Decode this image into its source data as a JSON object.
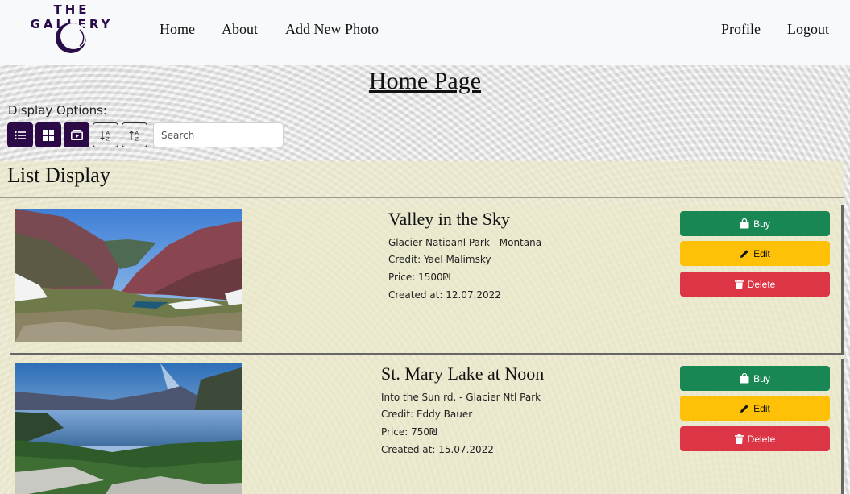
{
  "brand": {
    "name": "THE GALLERY",
    "logo_icon": "crescent-logo-icon",
    "color": "#2a0c48"
  },
  "nav": {
    "left": [
      {
        "label": "Home"
      },
      {
        "label": "About"
      },
      {
        "label": "Add New Photo"
      }
    ],
    "right": [
      {
        "label": "Profile"
      },
      {
        "label": "Logout"
      }
    ]
  },
  "main": {
    "title": "Home Page",
    "display_options_label": "Display Options:",
    "toolbar": [
      {
        "icon": "list-view-icon",
        "style": "dark"
      },
      {
        "icon": "grid-view-icon",
        "style": "dark"
      },
      {
        "icon": "carousel-view-icon",
        "style": "dark"
      },
      {
        "icon": "sort-ascending-icon",
        "style": "outline"
      },
      {
        "icon": "sort-descending-icon",
        "style": "outline"
      }
    ],
    "search": {
      "placeholder": "Search",
      "value": ""
    },
    "list_heading": "List Display"
  },
  "photos": [
    {
      "title": "Valley in the Sky",
      "location": "Glacier Natioanl Park - Montana",
      "credit": "Credit: Yael Malimsky",
      "price": "Price: 1500₪",
      "created": "Created at: 12.07.2022"
    },
    {
      "title": "St. Mary Lake at Noon",
      "location": "Into the Sun rd. - Glacier Ntl Park",
      "credit": "Credit: Eddy Bauer",
      "price": "Price: 750₪",
      "created": "Created at: 15.07.2022"
    }
  ],
  "actions": {
    "buy": "Buy",
    "edit": "Edit",
    "delete": "Delete"
  },
  "colors": {
    "primary_dark": "#2b0a47",
    "buy": "#198754",
    "edit": "#ffc107",
    "delete": "#dc3545"
  }
}
